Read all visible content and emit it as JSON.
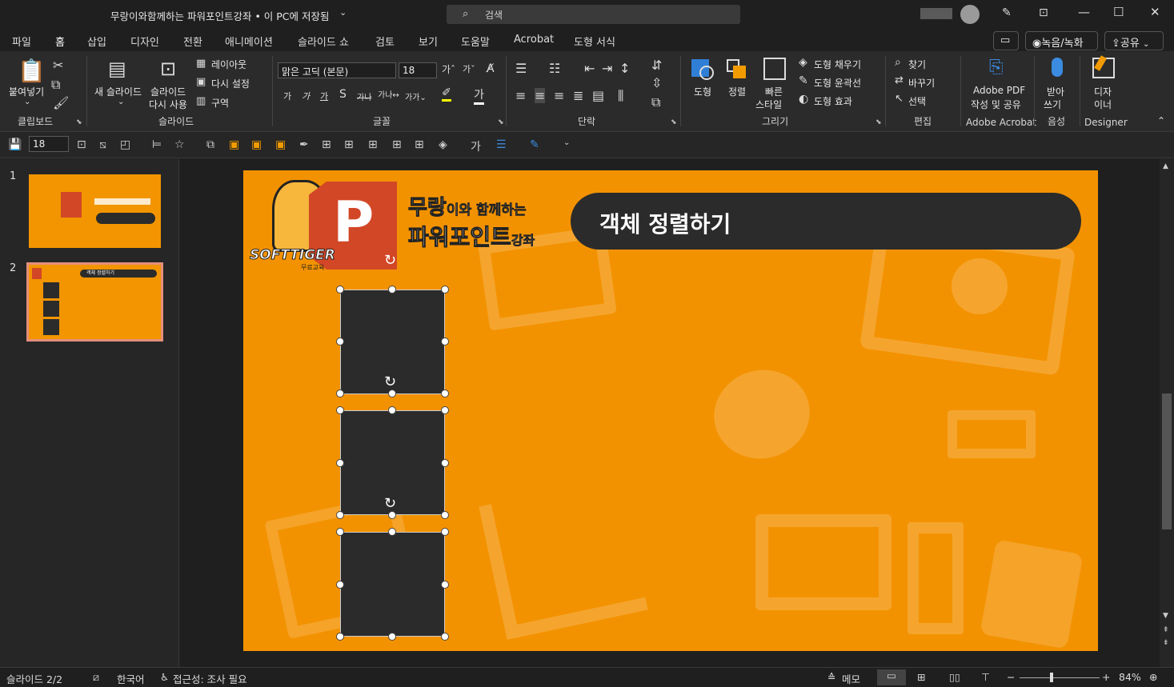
{
  "window": {
    "title": "무랑이와함께하는 파워포인트강좌 • 이 PC에 저장됨",
    "search_placeholder": "검색"
  },
  "tabs": [
    "파일",
    "홈",
    "삽입",
    "디자인",
    "전환",
    "애니메이션",
    "슬라이드 쇼",
    "검토",
    "보기",
    "도움말",
    "Acrobat",
    "도형 서식"
  ],
  "active_tab": "홈",
  "top_buttons": {
    "record": "녹음/녹화",
    "share": "공유"
  },
  "ribbon": {
    "clipboard": {
      "paste": "붙여넣기",
      "label": "클립보드"
    },
    "slides": {
      "new_slide": "새 슬라이드",
      "reuse_line1": "슬라이드",
      "reuse_line2": "다시 사용",
      "layout": "레이아웃",
      "reset": "다시 설정",
      "section": "구역",
      "label": "슬라이드"
    },
    "font": {
      "font_name": "맑은 고딕 (본문)",
      "font_size": "18",
      "label": "글꼴"
    },
    "paragraph": {
      "label": "단락"
    },
    "drawing": {
      "shape": "도형",
      "arrange": "정렬",
      "quick_line1": "빠른",
      "quick_line2": "스타일",
      "fill": "도형 채우기",
      "outline": "도형 윤곽선",
      "effects": "도형 효과",
      "label": "그리기"
    },
    "editing": {
      "find": "찾기",
      "replace": "바꾸기",
      "select": "선택",
      "label": "편집"
    },
    "acrobat": {
      "line1": "Adobe PDF",
      "line2": "작성 및 공유",
      "label": "Adobe Acrobat"
    },
    "voice": {
      "line1": "받아",
      "line2": "쓰기",
      "label": "음성"
    },
    "designer": {
      "line1": "디자",
      "line2": "이너",
      "label": "Designer"
    }
  },
  "qat": {
    "font_size": "18"
  },
  "slides_pane": {
    "slide1_num": "1",
    "slide2_num": "2",
    "thumb_title": "객체 정렬하기"
  },
  "slide": {
    "title": "객체 정렬하기",
    "banner_line1_a": "무랑",
    "banner_line1_b": "이와 함께하는",
    "banner_line2_a": "파워포인트",
    "banner_line2_b": "강좌",
    "logo_text": "SOFTTIGER",
    "logo_sub": "무료교육",
    "ppt_letter": "P"
  },
  "status": {
    "slide_counter": "슬라이드 2/2",
    "language": "한국어",
    "accessibility": "접근성: 조사 필요",
    "notes": "메모",
    "zoom": "84%"
  },
  "colors": {
    "slide_bg": "#f39200",
    "shape_fill": "#2b2b2b",
    "ppt_red": "#d24726",
    "thumb_selected": "#e58f7b"
  }
}
